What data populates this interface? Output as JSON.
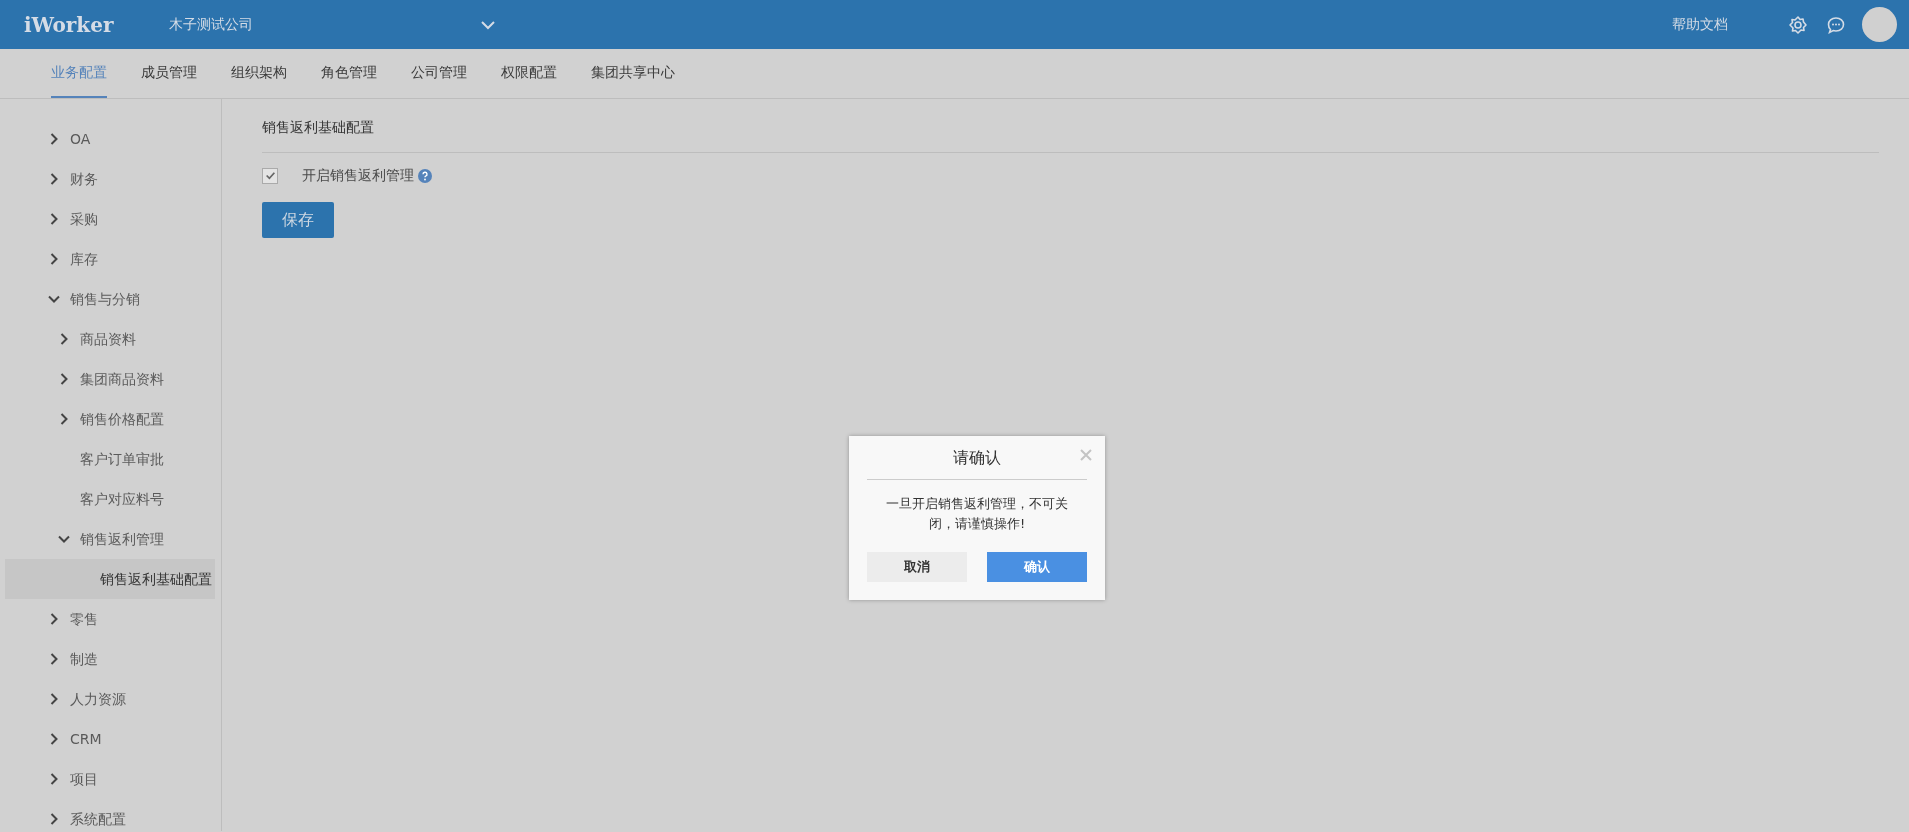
{
  "header": {
    "logo": "iWorker",
    "company": "木子测试公司",
    "help": "帮助文档"
  },
  "tabs": [
    {
      "label": "业务配置",
      "selected": true
    },
    {
      "label": "成员管理",
      "selected": false
    },
    {
      "label": "组织架构",
      "selected": false
    },
    {
      "label": "角色管理",
      "selected": false
    },
    {
      "label": "公司管理",
      "selected": false
    },
    {
      "label": "权限配置",
      "selected": false
    },
    {
      "label": "集团共享中心",
      "selected": false
    }
  ],
  "sidebar": {
    "items": [
      {
        "label": "OA",
        "kind": "group",
        "expanded": false
      },
      {
        "label": "财务",
        "kind": "group",
        "expanded": false
      },
      {
        "label": "采购",
        "kind": "group",
        "expanded": false
      },
      {
        "label": "库存",
        "kind": "group",
        "expanded": false
      },
      {
        "label": "销售与分销",
        "kind": "group",
        "expanded": true,
        "children": [
          {
            "label": "商品资料",
            "kind": "group",
            "expanded": false
          },
          {
            "label": "集团商品资料",
            "kind": "group",
            "expanded": false
          },
          {
            "label": "销售价格配置",
            "kind": "group",
            "expanded": false
          },
          {
            "label": "客户订单审批",
            "kind": "leaf",
            "selected": false
          },
          {
            "label": "客户对应料号",
            "kind": "leaf",
            "selected": false
          },
          {
            "label": "销售返利管理",
            "kind": "group",
            "expanded": true,
            "children": [
              {
                "label": "销售返利基础配置",
                "kind": "leaf",
                "selected": true
              }
            ]
          }
        ]
      },
      {
        "label": "零售",
        "kind": "group",
        "expanded": false
      },
      {
        "label": "制造",
        "kind": "group",
        "expanded": false
      },
      {
        "label": "人力资源",
        "kind": "group",
        "expanded": false
      },
      {
        "label": "CRM",
        "kind": "group",
        "expanded": false
      },
      {
        "label": "项目",
        "kind": "group",
        "expanded": false
      },
      {
        "label": "系统配置",
        "kind": "group",
        "expanded": false
      }
    ]
  },
  "main": {
    "title": "销售返利基础配置",
    "option": {
      "label": "开启销售返利管理",
      "checked": true
    },
    "save": "保存"
  },
  "dialog": {
    "title": "请确认",
    "message": "一旦开启销售返利管理，不可关闭，请谨慎操作!",
    "cancel": "取消",
    "confirm": "确认"
  }
}
